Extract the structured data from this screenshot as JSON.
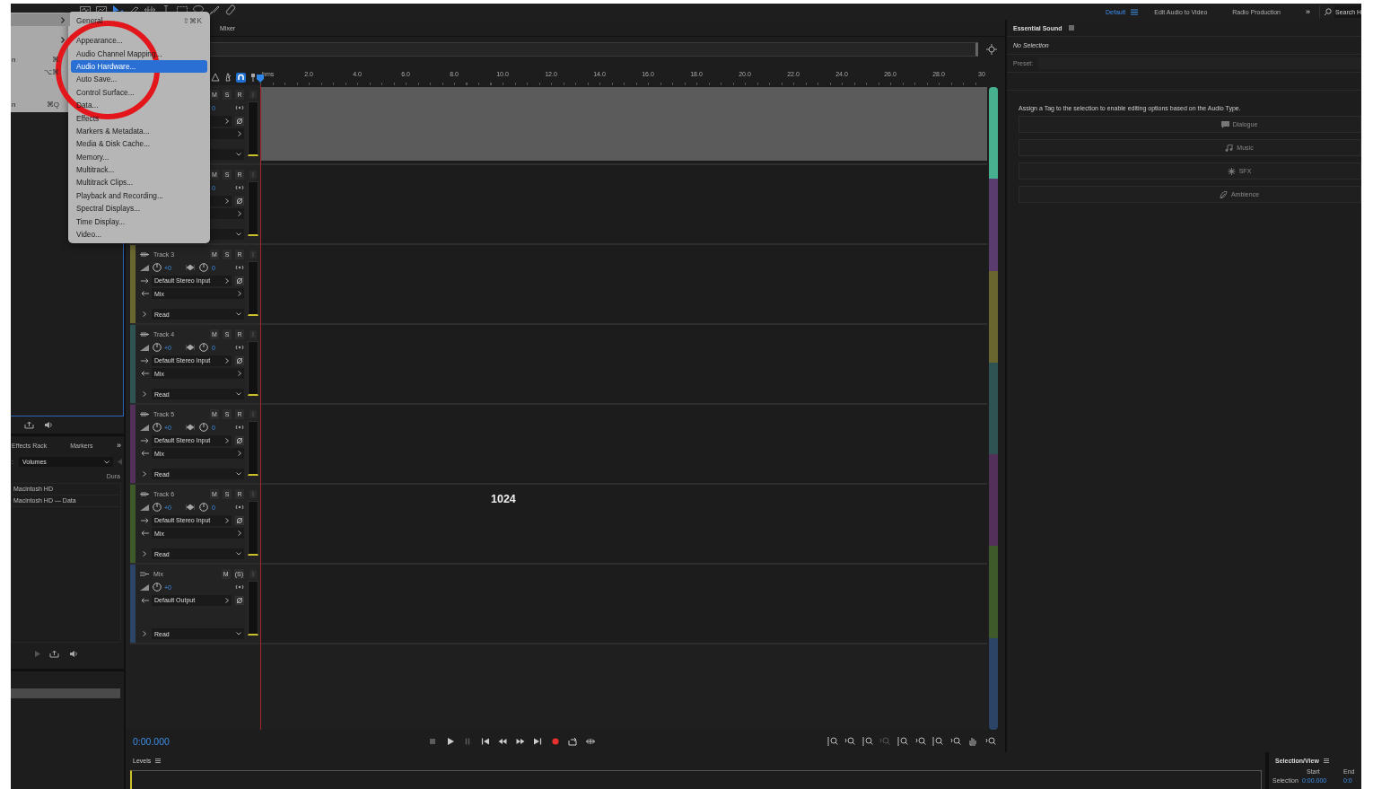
{
  "toolbar": {
    "tools": [
      {
        "kind": "waveform",
        "selected": false
      },
      {
        "kind": "spectral",
        "selected": false
      },
      {
        "kind": "move",
        "selected": true
      },
      {
        "kind": "razor",
        "selected": false
      },
      {
        "kind": "slip",
        "selected": false
      },
      {
        "kind": "time",
        "selected": false
      },
      {
        "kind": "marquee",
        "selected": false
      },
      {
        "kind": "lasso",
        "selected": false
      },
      {
        "kind": "brush",
        "selected": false
      },
      {
        "kind": "heal",
        "selected": false
      }
    ]
  },
  "workspaces": {
    "items": [
      {
        "label": "Default",
        "selected": true
      },
      {
        "label": "Edit Audio to Video",
        "selected": false
      },
      {
        "label": "Radio Production",
        "selected": false
      }
    ],
    "more": "»",
    "search": {
      "placeholder": "Search H"
    }
  },
  "app_menu": {
    "items": [
      {
        "kind": "submenu",
        "selected": true
      },
      {
        "kind": "separator"
      },
      {
        "kind": "submenu",
        "selected": false
      },
      {
        "kind": "separator"
      },
      {
        "kind": "command",
        "label": "n",
        "shortcut": "⌘",
        "selected": false
      },
      {
        "kind": "command",
        "shortcut": "⌥⌘",
        "selected": false
      },
      {
        "kind": "separator"
      },
      {
        "kind": "spacer"
      },
      {
        "kind": "command",
        "label": "n",
        "shortcut": "⌘Q",
        "selected": false
      }
    ]
  },
  "preferences_menu": {
    "items": [
      {
        "label": "General",
        "shortcut": "⇧⌘K",
        "selected": false
      },
      {
        "kind": "separator"
      },
      {
        "label": "Appearance...",
        "selected": false
      },
      {
        "label": "Audio Channel Mapping...",
        "selected": false
      },
      {
        "label": "Audio Hardware...",
        "selected": true
      },
      {
        "label": "Auto Save...",
        "selected": false
      },
      {
        "label": "Control Surface...",
        "selected": false
      },
      {
        "label": "Data...",
        "selected": false
      },
      {
        "label": "Effects",
        "selected": false
      },
      {
        "label": "Markers & Metadata...",
        "selected": false
      },
      {
        "label": "Media & Disk Cache...",
        "selected": false
      },
      {
        "label": "Memory...",
        "selected": false
      },
      {
        "label": "Multitrack...",
        "selected": false
      },
      {
        "label": "Multitrack Clips...",
        "selected": false
      },
      {
        "label": "Playback and Recording...",
        "selected": false
      },
      {
        "label": "Spectral Displays...",
        "selected": false
      },
      {
        "label": "Time Display...",
        "selected": false
      },
      {
        "label": "Video...",
        "selected": false
      }
    ]
  },
  "annotation": {
    "kind": "circle"
  },
  "files_panel": {
    "focused": true
  },
  "media_panel": {
    "tabs": [
      {
        "label": "Effects Rack",
        "selected": false
      },
      {
        "label": "Markers",
        "selected": false
      }
    ],
    "more": "»",
    "filter_label": ":",
    "filter": "Volumes",
    "column": "Dura",
    "rows": [
      "Macintosh HD",
      "Macintosh HD — Data"
    ]
  },
  "editor": {
    "tabs": [
      {
        "label": "Mixer",
        "selected": false
      }
    ],
    "ruler": {
      "unit": "hms",
      "ticks": [
        "2.0",
        "4.0",
        "6.0",
        "8.0",
        "10.0",
        "12.0",
        "14.0",
        "16.0",
        "18.0",
        "20.0",
        "22.0",
        "24.0",
        "26.0",
        "28.0"
      ],
      "last_tick": "30"
    },
    "tracks": [
      {
        "kind": "audio",
        "color": "#47b08e",
        "clip": true,
        "buttons": [
          "M",
          "S",
          "R"
        ],
        "pan": "0"
      },
      {
        "kind": "audio",
        "color": "#5a3d6e",
        "clip": false,
        "buttons": [
          "M",
          "S",
          "R"
        ],
        "pan": "0"
      },
      {
        "kind": "audio",
        "color": "#6a6630",
        "clip": false,
        "name": "Track 3",
        "buttons": [
          "M",
          "S",
          "R"
        ],
        "volume": "+0",
        "pan": "0",
        "input": "Default Stereo Input",
        "output": "Mix",
        "automation": "Read"
      },
      {
        "kind": "audio",
        "color": "#2f5252",
        "clip": false,
        "name": "Track 4",
        "buttons": [
          "M",
          "S",
          "R"
        ],
        "volume": "+0",
        "pan": "0",
        "input": "Default Stereo Input",
        "output": "Mix",
        "automation": "Read"
      },
      {
        "kind": "audio",
        "color": "#53305a",
        "clip": false,
        "name": "Track 5",
        "buttons": [
          "M",
          "S",
          "R"
        ],
        "volume": "+0",
        "pan": "0",
        "input": "Default Stereo Input",
        "output": "Mix",
        "automation": "Read"
      },
      {
        "kind": "audio",
        "color": "#3f5a2a",
        "clip": false,
        "name": "Track 6",
        "buttons": [
          "M",
          "S",
          "R"
        ],
        "volume": "+0",
        "pan": "0",
        "input": "Default Stereo Input",
        "output": "Mix",
        "automation": "Read"
      },
      {
        "kind": "master",
        "color": "#2c4466",
        "clip": false,
        "name": "Mix",
        "buttons": [
          "M",
          "(S)"
        ],
        "volume": "+0",
        "output": "Default Output",
        "automation": "Read"
      }
    ],
    "overlay_label": "1024",
    "time": "0:00.000"
  },
  "essential_sound": {
    "title": "Essential Sound",
    "selection": "No Selection",
    "preset_label": "Preset:",
    "hint": "Assign a Tag to the selection to enable editing options based on the Audio Type.",
    "tags": [
      {
        "kind": "dialogue",
        "label": "Dialogue"
      },
      {
        "kind": "music",
        "label": "Music"
      },
      {
        "kind": "sfx",
        "label": "SFX"
      },
      {
        "kind": "ambience",
        "label": "Ambience"
      }
    ]
  },
  "levels": {
    "title": "Levels"
  },
  "selection_view": {
    "title": "Selection/View",
    "columns": [
      "Start",
      "End"
    ],
    "rows": [
      {
        "label": "Selection",
        "start": "0:00.000",
        "end": "0:0"
      }
    ]
  }
}
